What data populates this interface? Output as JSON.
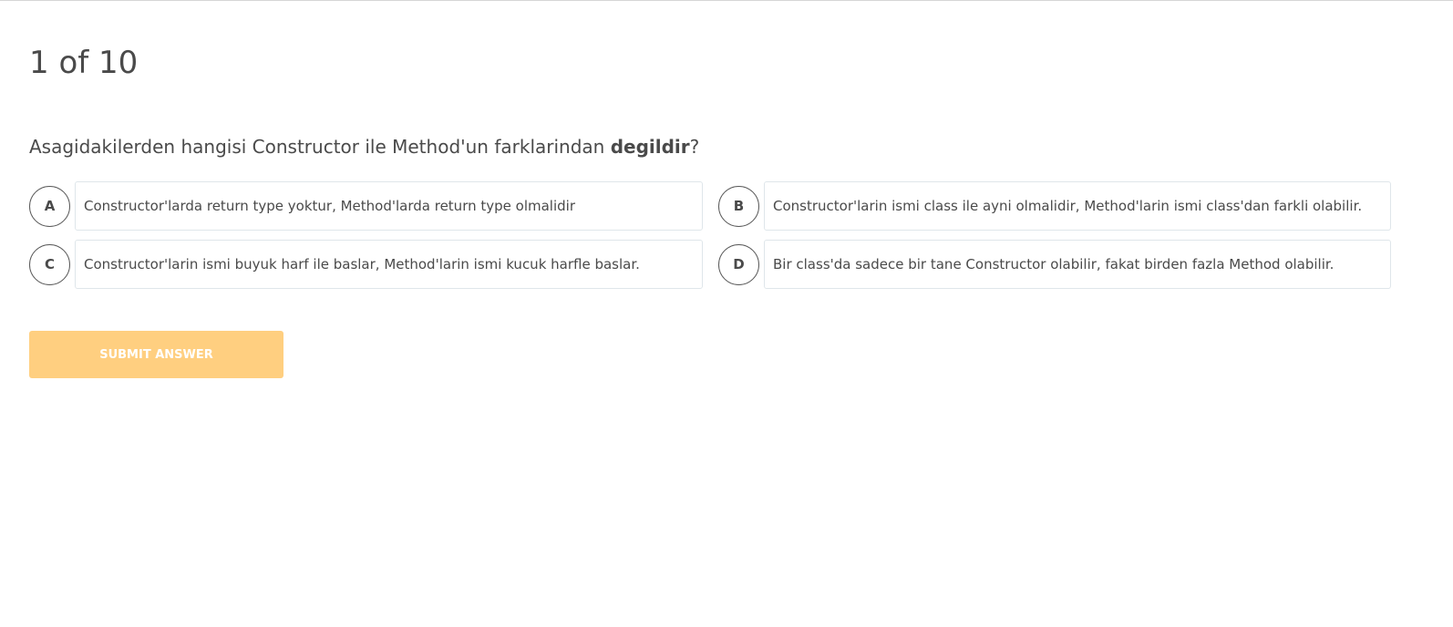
{
  "quiz": {
    "progress_label": "1 of 10",
    "question": {
      "prefix": "Asagidakilerden hangisi Constructor ile Method'un farklarindan ",
      "emphasis": "degildir",
      "suffix": "?"
    },
    "options": [
      {
        "letter": "A",
        "text": "Constructor'larda return type yoktur, Method'larda return type olmalidir"
      },
      {
        "letter": "B",
        "text": "Constructor'larin ismi class ile ayni olmalidir, Method'larin ismi class'dan farkli olabilir."
      },
      {
        "letter": "C",
        "text": "Constructor'larin ismi buyuk harf ile baslar, Method'larin ismi kucuk harfle baslar."
      },
      {
        "letter": "D",
        "text": "Bir class'da sadece bir tane Constructor olabilir, fakat birden fazla Method olabilir."
      }
    ],
    "submit_label": "SUBMIT ANSWER",
    "colors": {
      "submit_bg": "#ffcf80",
      "text": "#4a4a4a",
      "option_border": "#dfe6ea"
    }
  }
}
